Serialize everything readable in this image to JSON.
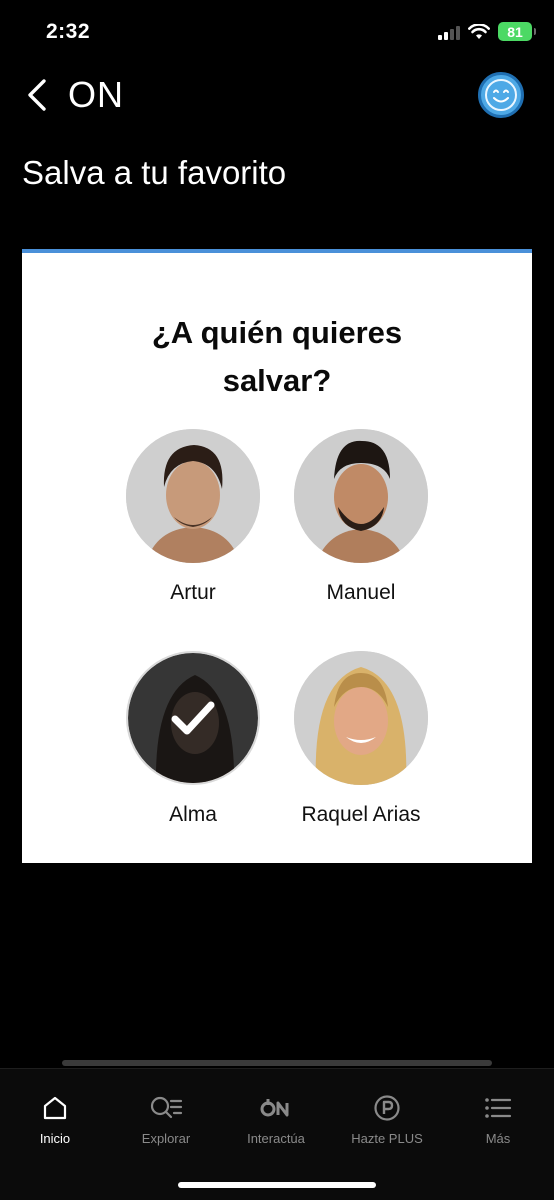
{
  "status_bar": {
    "time": "2:32",
    "battery": "81"
  },
  "header": {
    "title": "ON",
    "back_icon": "chevron-left-icon",
    "avatar_icon": "smiley-icon"
  },
  "page": {
    "title": "Salva a tu favorito"
  },
  "poll": {
    "question": "¿A quién quieres salvar?",
    "accent_color": "#4a90d9",
    "options": [
      {
        "name": "Artur",
        "selected": false
      },
      {
        "name": "Manuel",
        "selected": false
      },
      {
        "name": "Alma",
        "selected": true
      },
      {
        "name": "Raquel Arias",
        "selected": false
      }
    ]
  },
  "tab_bar": {
    "items": [
      {
        "label": "Inicio",
        "icon": "home-icon",
        "active": true
      },
      {
        "label": "Explorar",
        "icon": "explore-icon",
        "active": false
      },
      {
        "label": "Interactúa",
        "icon": "on-logo-icon",
        "active": false
      },
      {
        "label": "Hazte PLUS",
        "icon": "plus-p-icon",
        "active": false
      },
      {
        "label": "Más",
        "icon": "menu-list-icon",
        "active": false
      }
    ]
  }
}
